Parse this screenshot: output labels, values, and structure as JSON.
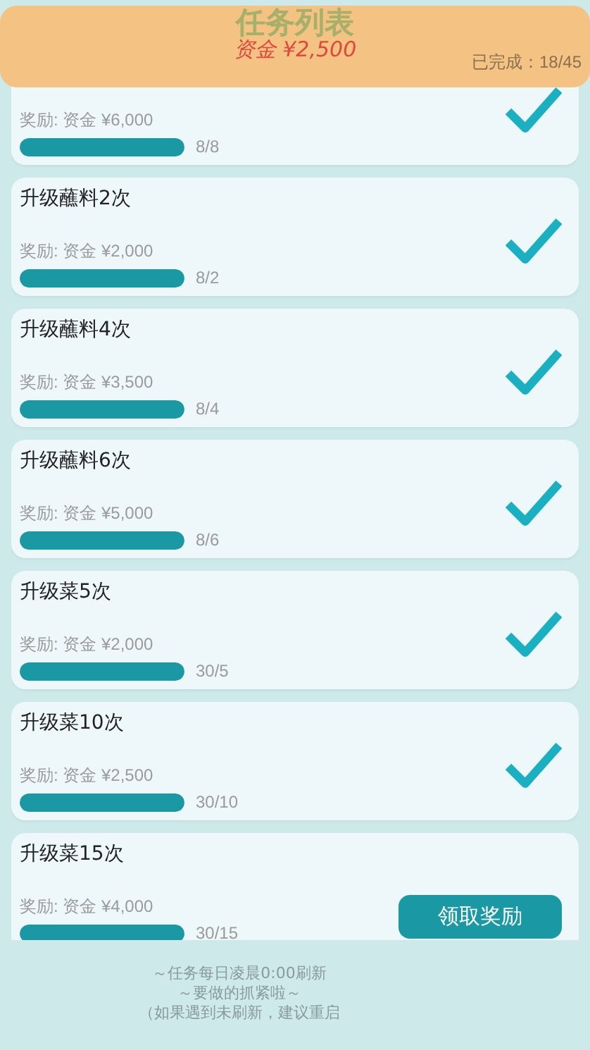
{
  "header": {
    "title": "任务列表",
    "money": "资金 ¥2,500",
    "completed": "已完成：18/45"
  },
  "tasks": [
    {
      "reward": "奖励: 资金 ¥6,000",
      "level": 1,
      "progress": "8/8",
      "kind": "done"
    },
    {
      "title": "升级蘸料2次",
      "reward": "奖励: 资金 ¥2,000",
      "level": 1,
      "progress": "8/2",
      "kind": "done"
    },
    {
      "title": "升级蘸料4次",
      "reward": "奖励: 资金 ¥3,500",
      "level": 1,
      "progress": "8/4",
      "kind": "done"
    },
    {
      "title": "升级蘸料6次",
      "reward": "奖励: 资金 ¥5,000",
      "level": 1,
      "progress": "8/6",
      "kind": "done"
    },
    {
      "title": "升级菜5次",
      "reward": "奖励: 资金 ¥2,000",
      "level": 1,
      "progress": "30/5",
      "kind": "done"
    },
    {
      "title": "升级菜10次",
      "reward": "奖励: 资金 ¥2,500",
      "level": 1,
      "progress": "30/10",
      "kind": "done"
    },
    {
      "title": "升级菜15次",
      "reward": "奖励: 资金 ¥4,000",
      "level": 1,
      "progress": "30/15",
      "kind": "claim",
      "button": "领取奖励"
    }
  ],
  "footer": [
    "～任务每日凌晨0:00刷新",
    "～要做的抓紧啦～",
    "（如果遇到未刷新，建议重启"
  ]
}
